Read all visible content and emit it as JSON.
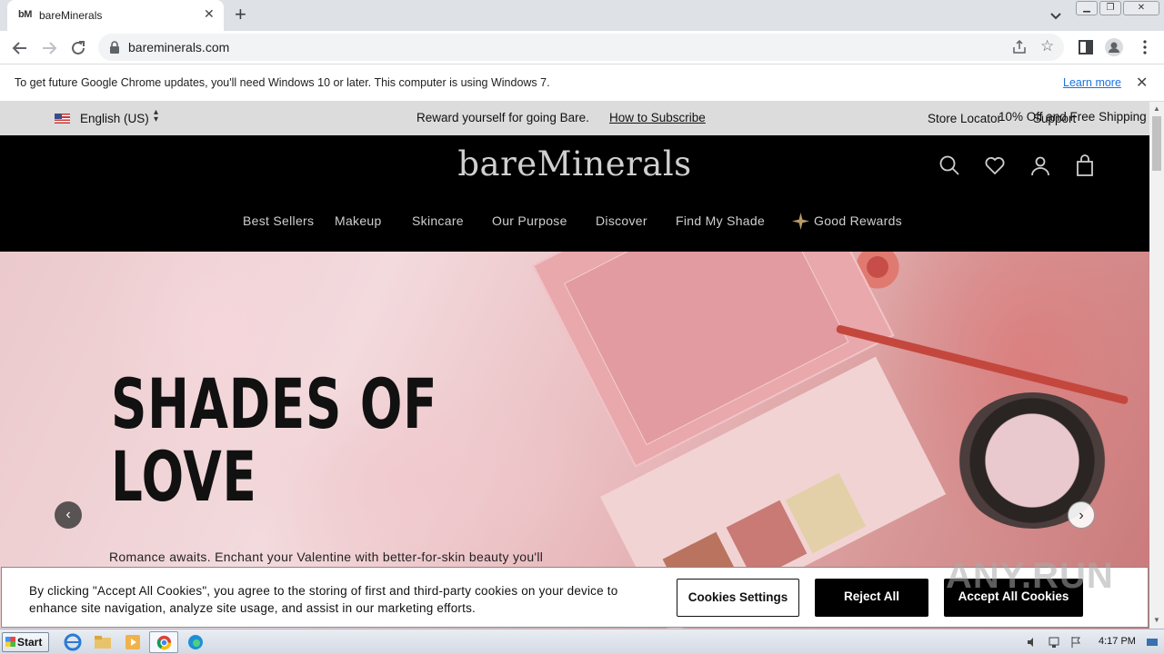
{
  "browser": {
    "tab": {
      "favicon": "bM",
      "title": "bareMinerals"
    },
    "url": "bareminerals.com",
    "infobar": {
      "message": "To get future Google Chrome updates, you'll need Windows 10 or later. This computer is using Windows 7.",
      "link": "Learn more"
    }
  },
  "promo_bar": {
    "language": "English (US)",
    "reward_text": "Reward yourself for going Bare.",
    "subscribe_link": "How to Subscribe",
    "store_locator": "Store Locator",
    "support": "Support",
    "offer": "10% Off and Free Shipping"
  },
  "header": {
    "logo": "bareMinerals",
    "nav": [
      "Best Sellers",
      "Makeup",
      "Skincare",
      "Our Purpose",
      "Discover",
      "Find My Shade",
      "Good Rewards"
    ]
  },
  "hero": {
    "headline_line1": "SHADES OF",
    "headline_line2": "LOVE",
    "subtext": "Romance awaits. Enchant your Valentine with better-for-skin beauty you'll"
  },
  "cookie_banner": {
    "text": "By clicking \"Accept All Cookies\", you agree to the storing of first and third-party cookies on your device to enhance site navigation, analyze site usage, and assist in our marketing efforts.",
    "settings_button": "Cookies Settings",
    "reject_button": "Reject All",
    "accept_button": "Accept All Cookies"
  },
  "watermark": "ANY.RUN",
  "taskbar": {
    "start_label": "Start",
    "time": "4:17 PM"
  }
}
